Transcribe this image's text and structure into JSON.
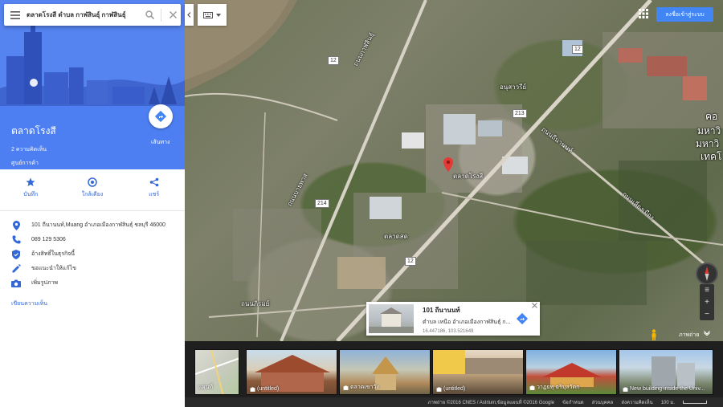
{
  "search": {
    "query": "ตลาดโรงสี ตำบล กาฬสินธุ์ กาฬสินธุ์"
  },
  "place": {
    "title": "ตลาดโรงสี",
    "subtitle": "2 ความคิดเห็น",
    "category": "ศูนย์การค้า",
    "directions_label": "เส้นทาง"
  },
  "actions": [
    {
      "label": "บันทึก",
      "icon": "star-icon"
    },
    {
      "label": "ใกล้เคียง",
      "icon": "nearby-icon"
    },
    {
      "label": "แชร์",
      "icon": "share-icon"
    }
  ],
  "info": {
    "address": "101 ถีนานนท์,Muang อำเภอเมืองกาฬสินธุ์ ชลบุรี 46000",
    "phone": "089 129 5306",
    "claim": "อ้างสิทธิ์ในธุรกิจนี้",
    "suggest_edit": "ขอแนะนำให้แก้ไข",
    "add_photo": "เพิ่มรูปภาพ",
    "write_review": "เขียนความเห็น"
  },
  "header": {
    "signin": "ลงชื่อเข้าสู่ระบบ"
  },
  "map": {
    "pin_label": "ตลาดโรงสี",
    "labels": [
      "ถนนกาฬสินธุ์",
      "ถนนบายพาส",
      "อนุสาวรีย์",
      "ตลาดสด",
      "ถนนถีนานนท์",
      "ถนนเลี่ยงเมือง",
      "ถนนภิรมย์"
    ],
    "right_edge_text": [
      "คอ",
      "มหาวิ",
      "มหาวิ",
      "เทคโ"
    ],
    "routes": [
      "12",
      "12",
      "12",
      "213",
      "214"
    ]
  },
  "placecard": {
    "name": "101 ถีนานนท์",
    "address": "ตำบล เหนือ อำเภอเมืองกาฬสินธุ์ ก...",
    "coords": "16.447186, 103.521649"
  },
  "streetview_label": "ภาพถ่าย",
  "filmstrip": [
    {
      "caption": "แผนที่"
    },
    {
      "caption": "(untitled)"
    },
    {
      "caption": "ตลาดเขาวัง"
    },
    {
      "caption": "(untitled)"
    },
    {
      "caption": "วาฏยทุ ฉริมุลวัดก"
    },
    {
      "caption": "New building inside the Univ..."
    }
  ],
  "footer": {
    "imagery": "ภาพถ่าย ©2016 CNES / Astrium,ข้อมูลแผนที่ ©2016 Google",
    "terms": "ข้อกำหนด",
    "privacy": "ส่วนบุคคล",
    "report": "ส่งความคิดเห็น",
    "scale": "100 ม."
  },
  "colors": {
    "accent": "#4d7ff3",
    "link": "#3367d6",
    "signin": "#4285f4",
    "pin": "#e53935"
  }
}
